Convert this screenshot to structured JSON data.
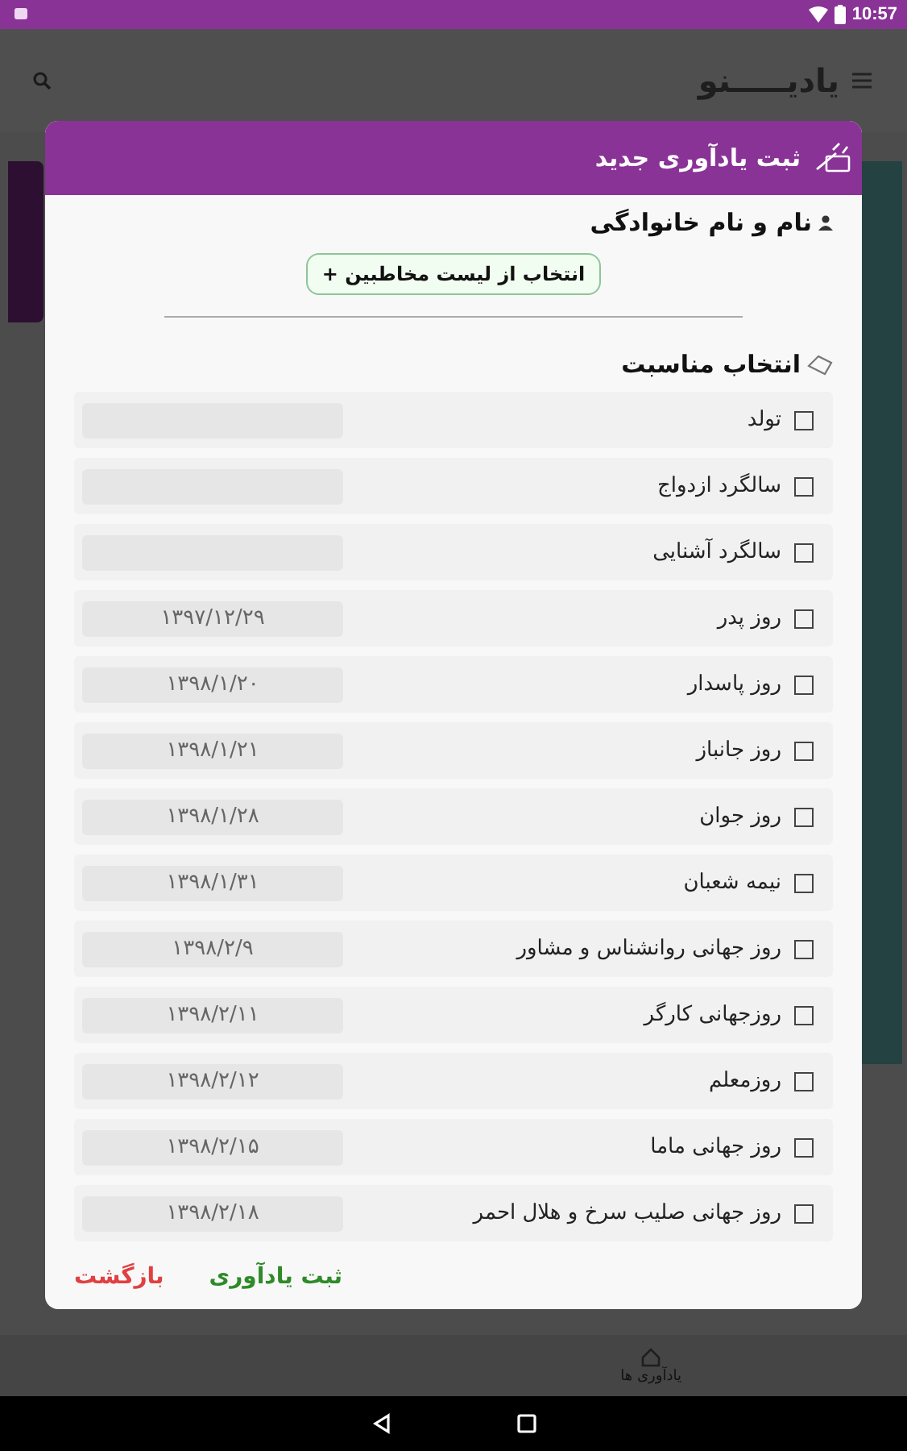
{
  "status_bar": {
    "time": "10:57"
  },
  "app_bar": {
    "title": "یادیـــــنو"
  },
  "dialog": {
    "title": "ثبت یادآوری جدید",
    "name_label": "نام و نام خانوادگی",
    "contacts_button": "انتخاب از لیست مخاطبین +",
    "occasion_heading": "انتخاب مناسبت",
    "occasions": [
      {
        "label": "تولد",
        "checked": false
      },
      {
        "label": "سالگرد ازدواج",
        "checked": false
      },
      {
        "label": "سالگرد آشنایی",
        "checked": false
      },
      {
        "label": "روز پدر",
        "checked": false,
        "date": "۱۳۹۷/۱۲/۲۹"
      },
      {
        "label": "روز پاسدار",
        "checked": false,
        "date": "۱۳۹۸/۱/۲۰"
      },
      {
        "label": "روز جانباز",
        "checked": false,
        "date": "۱۳۹۸/۱/۲۱"
      },
      {
        "label": "روز جوان",
        "checked": false,
        "date": "۱۳۹۸/۱/۲۸"
      },
      {
        "label": "نیمه شعبان",
        "checked": false,
        "date": "۱۳۹۸/۱/۳۱"
      },
      {
        "label": "روز جهانی روانشناس و مشاور",
        "checked": false,
        "date": "۱۳۹۸/۲/۹"
      },
      {
        "label": "روزجهانی کارگر",
        "checked": false,
        "date": "۱۳۹۸/۲/۱۱"
      },
      {
        "label": "روزمعلم",
        "checked": false,
        "date": "۱۳۹۸/۲/۱۲"
      },
      {
        "label": "روز جهانی ماما",
        "checked": false,
        "date": "۱۳۹۸/۲/۱۵"
      },
      {
        "label": "روز جهانی صلیب سرخ و هلال احمر",
        "checked": false,
        "date": "۱۳۹۸/۲/۱۸"
      }
    ],
    "buttons": [
      {
        "label": "ثبت یادآوری",
        "kind": "confirm"
      },
      {
        "label": "بازگشت",
        "kind": "cancel"
      }
    ]
  },
  "bottom_nav": {
    "items": [
      {
        "label": "یادآوری ها"
      }
    ]
  }
}
